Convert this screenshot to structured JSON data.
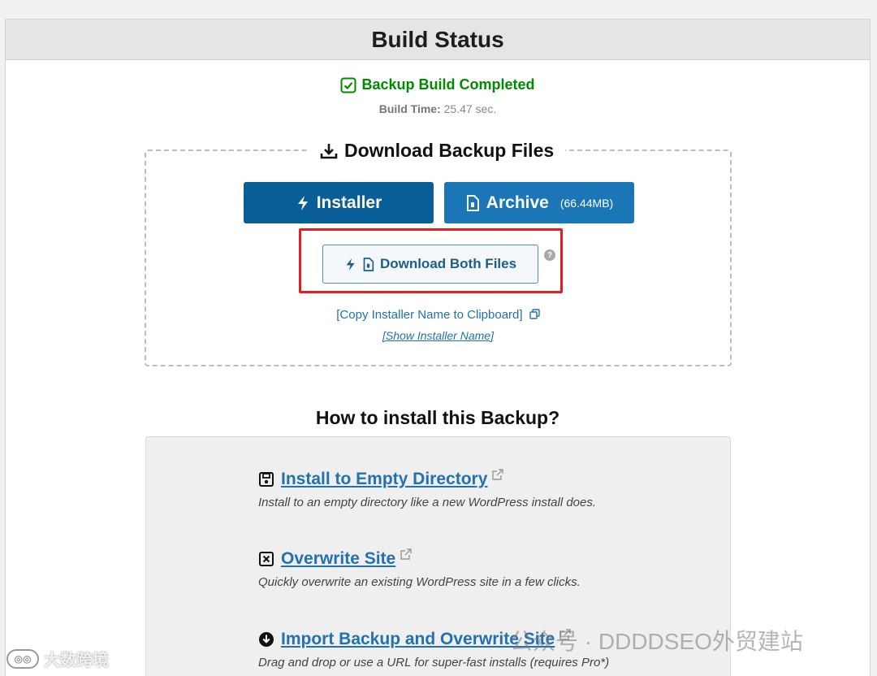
{
  "header": {
    "title": "Build Status"
  },
  "status": {
    "message": "Backup Build Completed",
    "build_time_label": "Build Time:",
    "build_time_value": "25.47 sec.",
    "color": "#008a00"
  },
  "download": {
    "legend": "Download Backup Files",
    "installer_label": "Installer",
    "archive_label": "Archive",
    "archive_size": "(66.44MB)",
    "both_label": "Download Both Files",
    "help": "?",
    "copy_link": "[Copy Installer Name to Clipboard]",
    "show_link": "[Show Installer Name]"
  },
  "howto": {
    "title": "How to install this Backup?",
    "methods": [
      {
        "icon": "save-icon",
        "label": "Install to Empty Directory",
        "desc": "Install to an empty directory like a new WordPress install does."
      },
      {
        "icon": "x-square-icon",
        "label": "Overwrite Site",
        "desc": "Quickly overwrite an existing WordPress site in a few clicks."
      },
      {
        "icon": "download-circle-icon",
        "label": "Import Backup and Overwrite Site",
        "desc": "Drag and drop or use a URL for super-fast installs (requires Pro*)"
      }
    ]
  },
  "watermarks": {
    "left": "大数跨境",
    "right": "公众号 · DDDDSEO外贸建站"
  },
  "colors": {
    "primary_dark": "#0a5e98",
    "primary": "#1b76b8",
    "link": "#2271b1",
    "highlight": "#e02020"
  }
}
